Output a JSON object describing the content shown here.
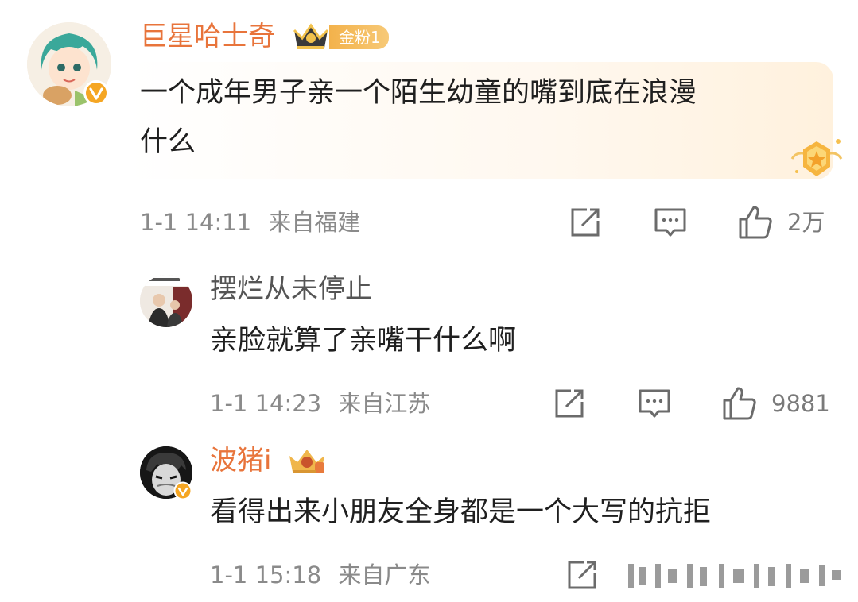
{
  "comments": [
    {
      "username": "巨星哈士奇",
      "fan_badge": "金粉1",
      "text_line1": "一个成年男子亲一个陌生幼童的嘴到底在浪漫",
      "text_line2": "什么",
      "time": "1-1 14:11",
      "location": "来自福建",
      "likes": "2万"
    },
    {
      "username": "摆烂从未停止",
      "text": "亲脸就算了亲嘴干什么啊",
      "time": "1-1 14:23",
      "location": "来自江苏",
      "likes": "9881"
    },
    {
      "username": "波猪i",
      "text": "看得出来小朋友全身都是一个大写的抗拒",
      "time": "1-1 15:18",
      "location": "来自广东"
    }
  ],
  "icons": {
    "share": "share-icon",
    "comment": "comment-icon",
    "like": "thumbs-up-icon",
    "verified": "verified-v-icon",
    "crown": "crown-badge-icon"
  },
  "colors": {
    "username_highlight": "#e8743b",
    "verified": "#f5a623",
    "meta_text": "#8a8a8a"
  }
}
